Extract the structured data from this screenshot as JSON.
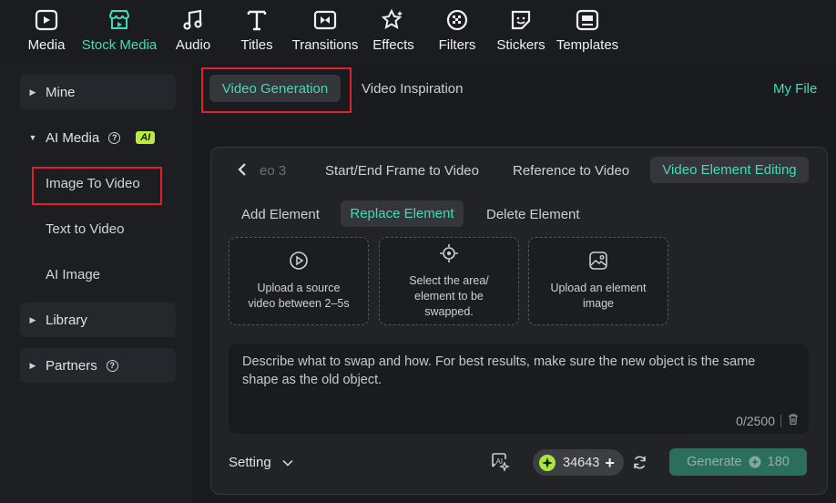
{
  "toolbar": {
    "items": [
      {
        "label": "Media",
        "icon": "media-icon"
      },
      {
        "label": "Stock Media",
        "icon": "stock-media-icon",
        "active": true
      },
      {
        "label": "Audio",
        "icon": "music-note-icon"
      },
      {
        "label": "Titles",
        "icon": "text-t-icon"
      },
      {
        "label": "Transitions",
        "icon": "transition-icon"
      },
      {
        "label": "Effects",
        "icon": "effects-icon"
      },
      {
        "label": "Filters",
        "icon": "filter-icon"
      },
      {
        "label": "Stickers",
        "icon": "sticker-icon"
      },
      {
        "label": "Templates",
        "icon": "template-icon"
      }
    ],
    "accent": "#3fdcb8"
  },
  "sidebar": {
    "mine": "Mine",
    "ai_media": "AI Media",
    "ai_badge": "AI",
    "image_to_video": "Image To Video",
    "text_to_video": "Text to Video",
    "ai_image": "AI Image",
    "library": "Library",
    "partners": "Partners"
  },
  "main": {
    "tab_generation": "Video Generation",
    "tab_inspiration": "Video Inspiration",
    "my_file": "My File",
    "mode_tabs": {
      "truncated": "eo 3",
      "start_end": "Start/End Frame to Video",
      "reference": "Reference to Video",
      "element_editing": "Video Element Editing"
    },
    "sub_tabs": {
      "add": "Add Element",
      "replace": "Replace Element",
      "delete": "Delete Element"
    },
    "cards": {
      "upload_source": "Upload a source\nvideo between 2–5s",
      "select_area": "Select the area/\nelement to be\nswapped.",
      "upload_element": "Upload an element\nimage"
    },
    "prompt_placeholder": "Describe what to swap and how. For best results, make sure the new object is the same shape as the old object.",
    "char_count": "0/2500",
    "setting": "Setting",
    "credits": "34643",
    "generate": "Generate",
    "generate_cost": "180"
  }
}
